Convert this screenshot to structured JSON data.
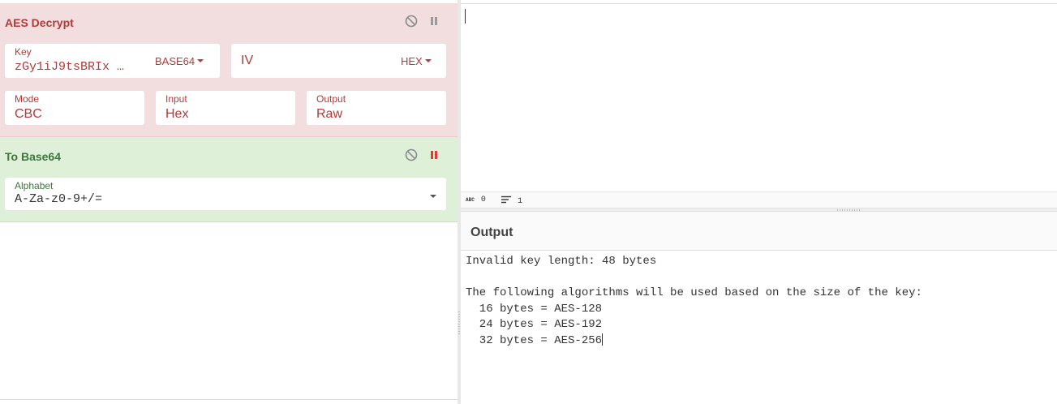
{
  "recipe": {
    "aes_decrypt": {
      "title": "AES Decrypt",
      "key": {
        "label": "Key",
        "value": "zGy1iJ9tsBRIx …",
        "encoding": "BASE64"
      },
      "iv": {
        "label": "IV",
        "encoding": "HEX"
      },
      "mode": {
        "label": "Mode",
        "value": "CBC"
      },
      "input": {
        "label": "Input",
        "value": "Hex"
      },
      "output": {
        "label": "Output",
        "value": "Raw"
      },
      "icons": {
        "disable": "disable-icon",
        "pause": "pause-icon"
      },
      "colors": {
        "background": "#f2dede",
        "text": "#b33a3a"
      }
    },
    "to_base64": {
      "title": "To Base64",
      "alphabet": {
        "label": "Alphabet",
        "value": "A-Za-z0-9+/="
      },
      "icons": {
        "disable": "disable-icon",
        "pause": "pause-icon"
      },
      "colors": {
        "background": "#dff0d8",
        "text": "#3c763d",
        "pause_active": "#e53935"
      }
    }
  },
  "input_status": {
    "length": "0",
    "lines": "1"
  },
  "output": {
    "title": "Output",
    "lines": [
      "Invalid key length: 48 bytes",
      "",
      "The following algorithms will be used based on the size of the key:",
      "  16 bytes = AES-128",
      "  24 bytes = AES-192",
      "  32 bytes = AES-256"
    ]
  }
}
